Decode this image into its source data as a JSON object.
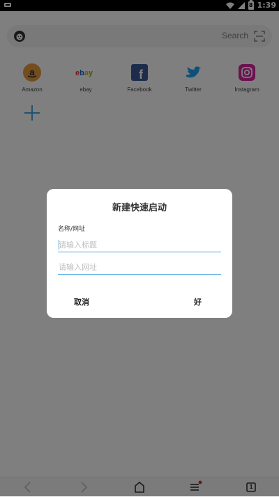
{
  "status_bar": {
    "time": "1:39",
    "battery_level": "8",
    "icons": [
      "notification-icon",
      "wifi-icon",
      "signal-icon",
      "battery-icon"
    ]
  },
  "search": {
    "placeholder": "Search",
    "icons": [
      "lion-logo-icon",
      "scan-icon"
    ]
  },
  "shortcuts": [
    {
      "label": "Amazon",
      "icon": "amazon-icon",
      "color": "#e89a3c"
    },
    {
      "label": "ebay",
      "icon": "ebay-icon",
      "color": "#e53238"
    },
    {
      "label": "Facebook",
      "icon": "facebook-icon",
      "color": "#3b5998"
    },
    {
      "label": "Twitter",
      "icon": "twitter-icon",
      "color": "#1da1f2"
    },
    {
      "label": "Instagram",
      "icon": "instagram-icon",
      "color": "#d6249f"
    }
  ],
  "add_shortcut": {
    "icon": "plus-icon",
    "color": "#4aa3df"
  },
  "dialog": {
    "title": "新建快速启动",
    "field_label": "名称/网址",
    "title_placeholder": "请输入标题",
    "url_placeholder": "请输入网址",
    "cancel_label": "取消",
    "ok_label": "好"
  },
  "bottom_bar": {
    "icons": [
      "back-icon",
      "forward-icon",
      "home-icon",
      "menu-icon",
      "tabs-icon"
    ],
    "tabs_count": "1",
    "menu_badge_color": "#d32f2f"
  },
  "colors": {
    "accent": "#4aa3df",
    "overlay": "rgba(0,0,0,0.5)"
  }
}
